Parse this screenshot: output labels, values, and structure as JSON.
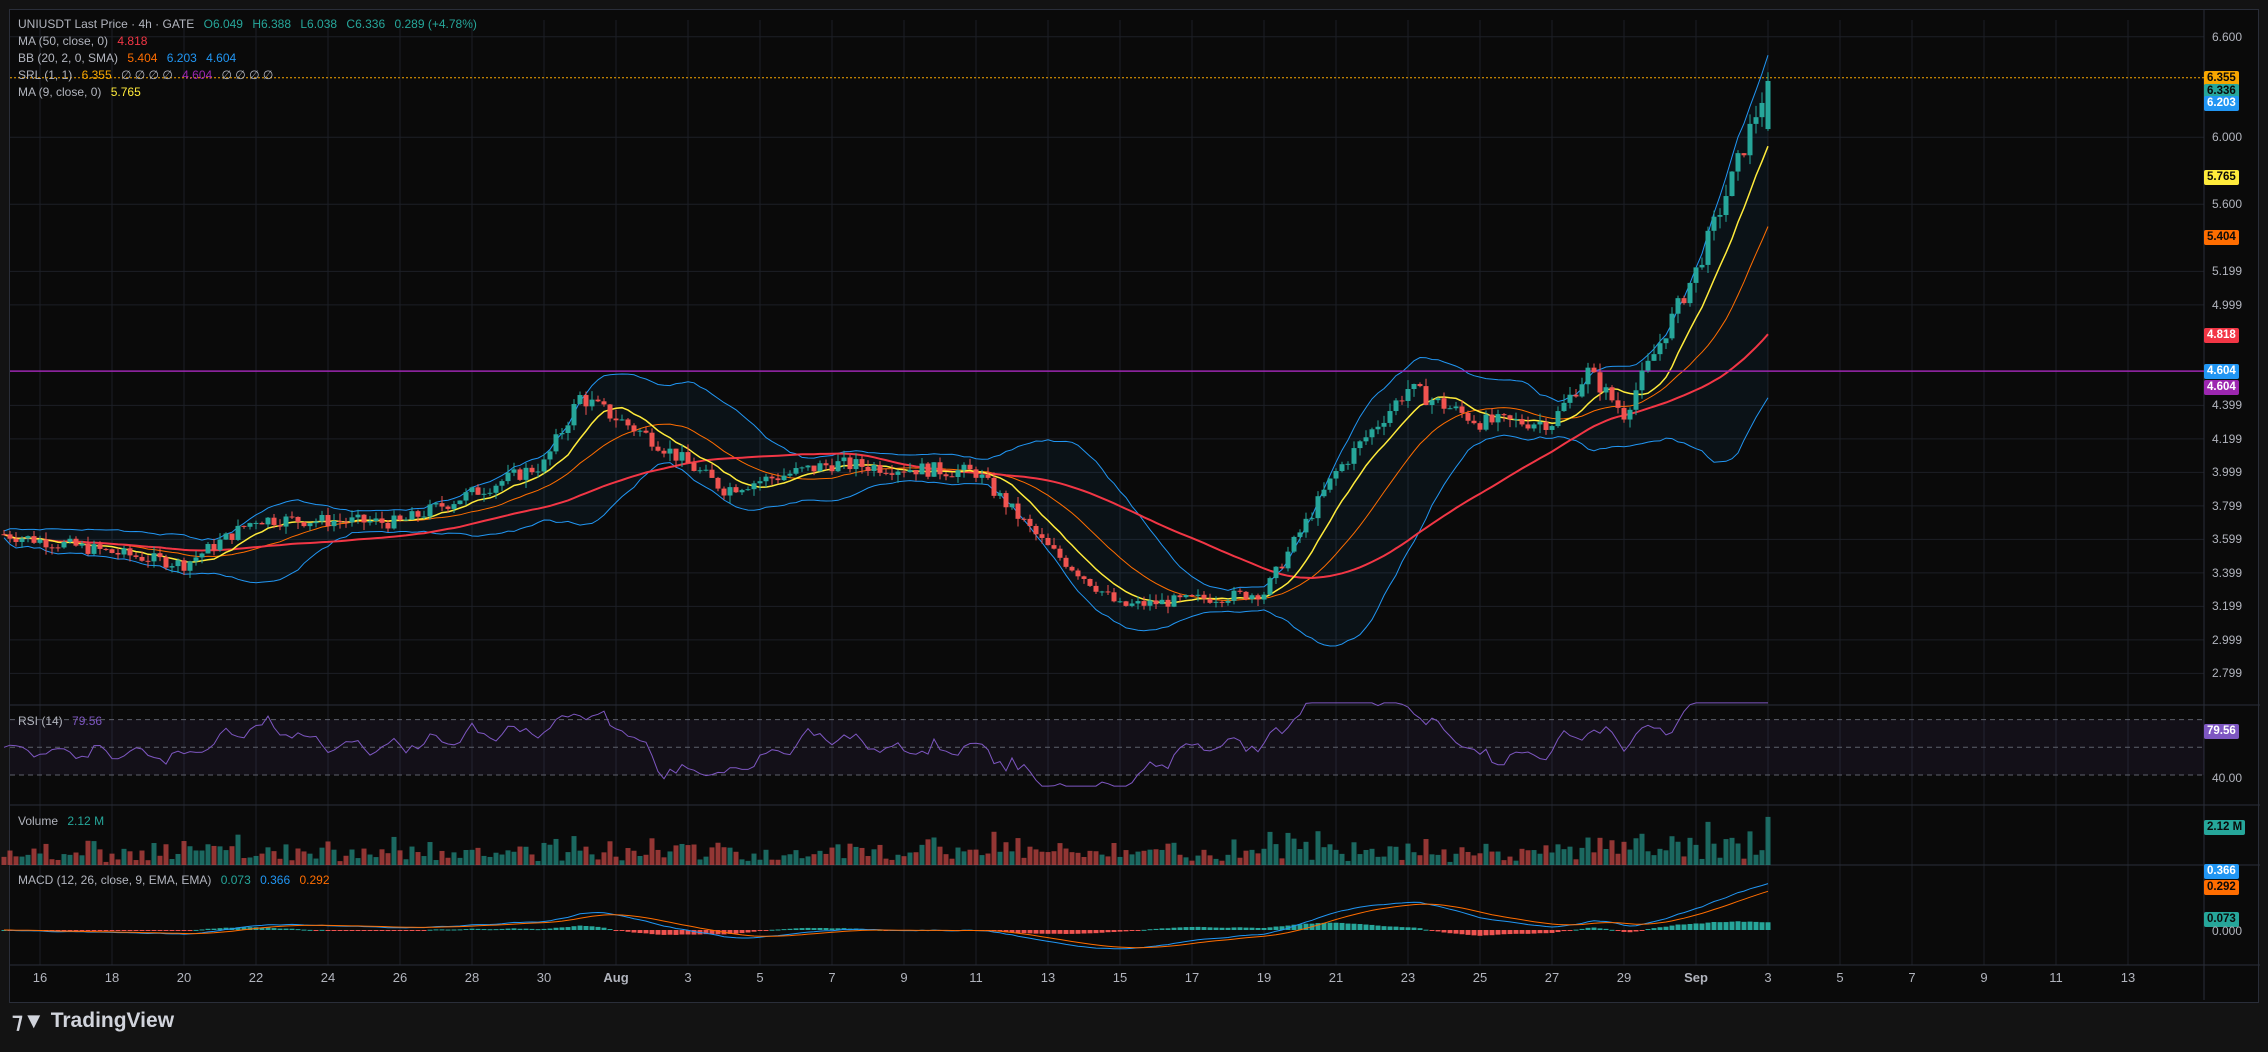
{
  "header": {
    "symbol": "UNIUSDT Last Price · 4h · GATE",
    "open": "O6.049",
    "high": "H6.388",
    "low": "L6.038",
    "close": "C6.336",
    "change": "0.289 (+4.78%)"
  },
  "indicators": {
    "ma50": {
      "label": "MA (50, close, 0)",
      "value": "4.818"
    },
    "bb": {
      "label": "BB (20, 2, 0, SMA)",
      "basis": "5.404",
      "upper": "6.203",
      "lower": "4.604"
    },
    "srl": {
      "label": "SRL (1, 1)",
      "v1": "6.355",
      "na1": "∅ ∅ ∅ ∅",
      "v2": "4.604",
      "na2": "∅ ∅ ∅ ∅"
    },
    "ma9": {
      "label": "MA (9, close, 0)",
      "value": "5.765"
    },
    "rsi": {
      "label": "RSI (14)",
      "value": "79.56",
      "axis_mid": "40.00"
    },
    "volume": {
      "label": "Volume",
      "value": "2.12 M",
      "tag": "2.12 M"
    },
    "macd": {
      "label": "MACD (12, 26, close, 9, EMA, EMA)",
      "hist": "0.073",
      "macd": "0.366",
      "signal": "0.292",
      "axis_zero": "0.000"
    }
  },
  "price_axis": [
    "6.600",
    "6.000",
    "5.600",
    "5.199",
    "4.999",
    "4.399",
    "4.199",
    "3.999",
    "3.799",
    "3.599",
    "3.399",
    "3.199",
    "2.999",
    "2.799"
  ],
  "price_tags": [
    {
      "label": "6.355",
      "color": "#f7a600"
    },
    {
      "label": "6.336",
      "color": "#26a69a"
    },
    {
      "label": "6.203",
      "color": "#2196f3"
    },
    {
      "label": "5.765",
      "color": "#ffeb3b"
    },
    {
      "label": "5.404",
      "color": "#ff6d00"
    },
    {
      "label": "4.818",
      "color": "#f23645"
    },
    {
      "label": "4.604",
      "color": "#2196f3"
    },
    {
      "label": "4.604",
      "color": "#9c27b0"
    }
  ],
  "x_axis": [
    "16",
    "18",
    "20",
    "22",
    "24",
    "26",
    "28",
    "30",
    "Aug",
    "3",
    "5",
    "7",
    "9",
    "11",
    "13",
    "15",
    "17",
    "19",
    "21",
    "23",
    "25",
    "27",
    "29",
    "Sep",
    "3",
    "5",
    "7",
    "9",
    "11",
    "13"
  ],
  "brand": "TradingView",
  "colors": {
    "up": "#26a69a",
    "down": "#ef5350",
    "ma9": "#ffeb3b",
    "ma50": "#f23645",
    "bb_basis": "#ff6d00",
    "bb_band": "#2196f3",
    "srl": "#9c27b0",
    "rsi": "#7e57c2",
    "macd": "#2196f3",
    "signal": "#ff6d00"
  },
  "chart_data": {
    "type": "candlestick",
    "title": "UNIUSDT Last Price · 4h · GATE",
    "ylim": [
      2.7,
      6.7
    ],
    "x_range": [
      "Jul 15",
      "Sep 14"
    ],
    "key_points": [
      {
        "date": "Jul 15",
        "price": 3.63
      },
      {
        "date": "Jul 20",
        "price": 3.45
      },
      {
        "date": "Jul 22",
        "price": 3.72
      },
      {
        "date": "Jul 26",
        "price": 3.7
      },
      {
        "date": "Jul 30",
        "price": 4.05
      },
      {
        "date": "Jul 31",
        "price": 4.45
      },
      {
        "date": "Aug 2",
        "price": 4.2
      },
      {
        "date": "Aug 4",
        "price": 3.9
      },
      {
        "date": "Aug 7",
        "price": 4.05
      },
      {
        "date": "Aug 11",
        "price": 4.0
      },
      {
        "date": "Aug 13",
        "price": 3.55
      },
      {
        "date": "Aug 15",
        "price": 3.2
      },
      {
        "date": "Aug 19",
        "price": 3.28
      },
      {
        "date": "Aug 21",
        "price": 4.0
      },
      {
        "date": "Aug 23",
        "price": 4.5
      },
      {
        "date": "Aug 25",
        "price": 4.3
      },
      {
        "date": "Aug 27",
        "price": 4.3
      },
      {
        "date": "Aug 28",
        "price": 4.6
      },
      {
        "date": "Aug 29",
        "price": 4.35
      },
      {
        "date": "Aug 31",
        "price": 5.2
      },
      {
        "date": "Sep 1",
        "price": 5.75
      },
      {
        "date": "Sep 2",
        "price": 6.336
      }
    ],
    "last": {
      "open": 6.049,
      "high": 6.388,
      "low": 6.038,
      "close": 6.336
    },
    "support_level": 4.604,
    "resistance_level": 6.355
  }
}
